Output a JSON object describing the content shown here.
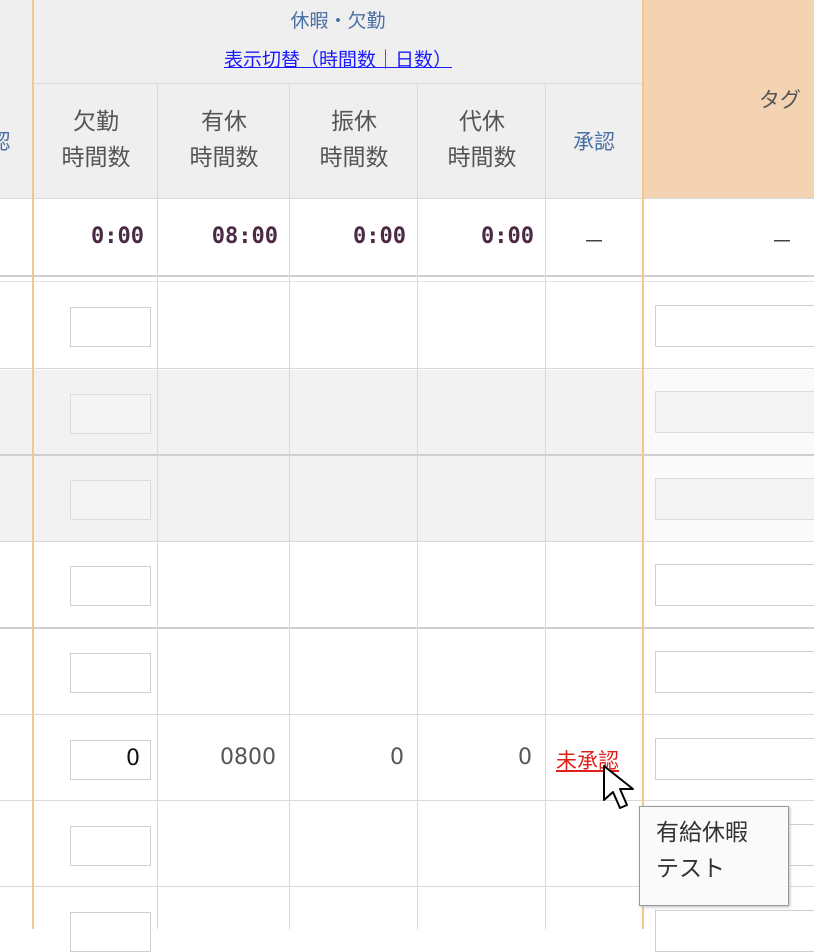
{
  "header": {
    "group_title": "休暇・欠勤",
    "toggle_link": "表示切替（時間数｜日数）",
    "left_cut_char": "認",
    "tag_label": "タグ",
    "columns": [
      {
        "line1": "欠勤",
        "line2": "時間数"
      },
      {
        "line1": "有休",
        "line2": "時間数"
      },
      {
        "line1": "振休",
        "line2": "時間数"
      },
      {
        "line1": "代休",
        "line2": "時間数"
      }
    ],
    "approval_label": "承認"
  },
  "summary": {
    "absence": "0:00",
    "paid_leave": "08:00",
    "transfer": "0:00",
    "compensatory": "0:00",
    "approval": "－",
    "tag": "－"
  },
  "entry": {
    "absence_value": "0",
    "paid_leave": "0800",
    "transfer": "0",
    "compensatory": "0",
    "approval_status": "未承認"
  },
  "tooltip": {
    "line1": "有給休暇",
    "line2": "テスト"
  },
  "colors": {
    "header_bg": "#efefef",
    "tag_header_bg": "#f4d3b3",
    "divider_orange": "#f2c98a",
    "status_red": "#e0201a",
    "link_blue": "#1a1aff",
    "header_blue": "#4a6fa5"
  }
}
